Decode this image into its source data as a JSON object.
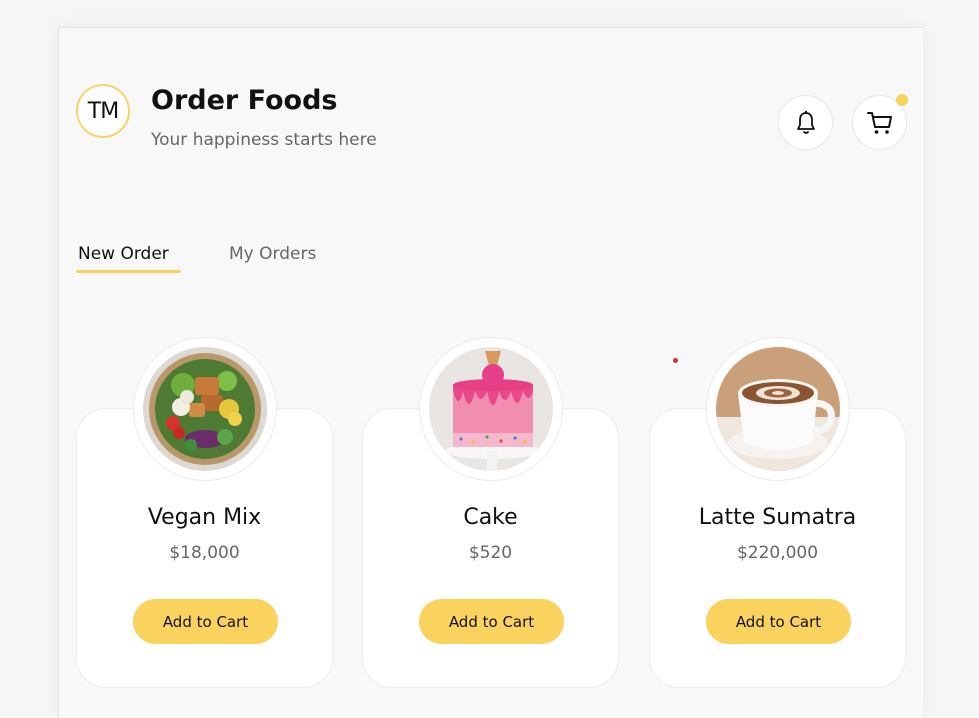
{
  "header": {
    "logo_text": "TM",
    "title": "Order Foods",
    "subtitle": "Your happiness starts here",
    "bell_icon": "bell-icon",
    "cart_icon": "cart-icon",
    "cart_badge_color": "#f9d35e"
  },
  "tabs": [
    {
      "label": "New Order",
      "active": true
    },
    {
      "label": "My Orders",
      "active": false
    }
  ],
  "colors": {
    "accent": "#f9d35e",
    "text_primary": "#111111",
    "text_secondary": "#666666"
  },
  "products": [
    {
      "name": "Vegan Mix",
      "price": "$18,000",
      "button_label": "Add to Cart",
      "image": "salad-bowl"
    },
    {
      "name": "Cake",
      "price": "$520",
      "button_label": "Add to Cart",
      "image": "pink-drip-cake"
    },
    {
      "name": "Latte Sumatra",
      "price": "$220,000",
      "button_label": "Add to Cart",
      "image": "latte-cup"
    }
  ]
}
